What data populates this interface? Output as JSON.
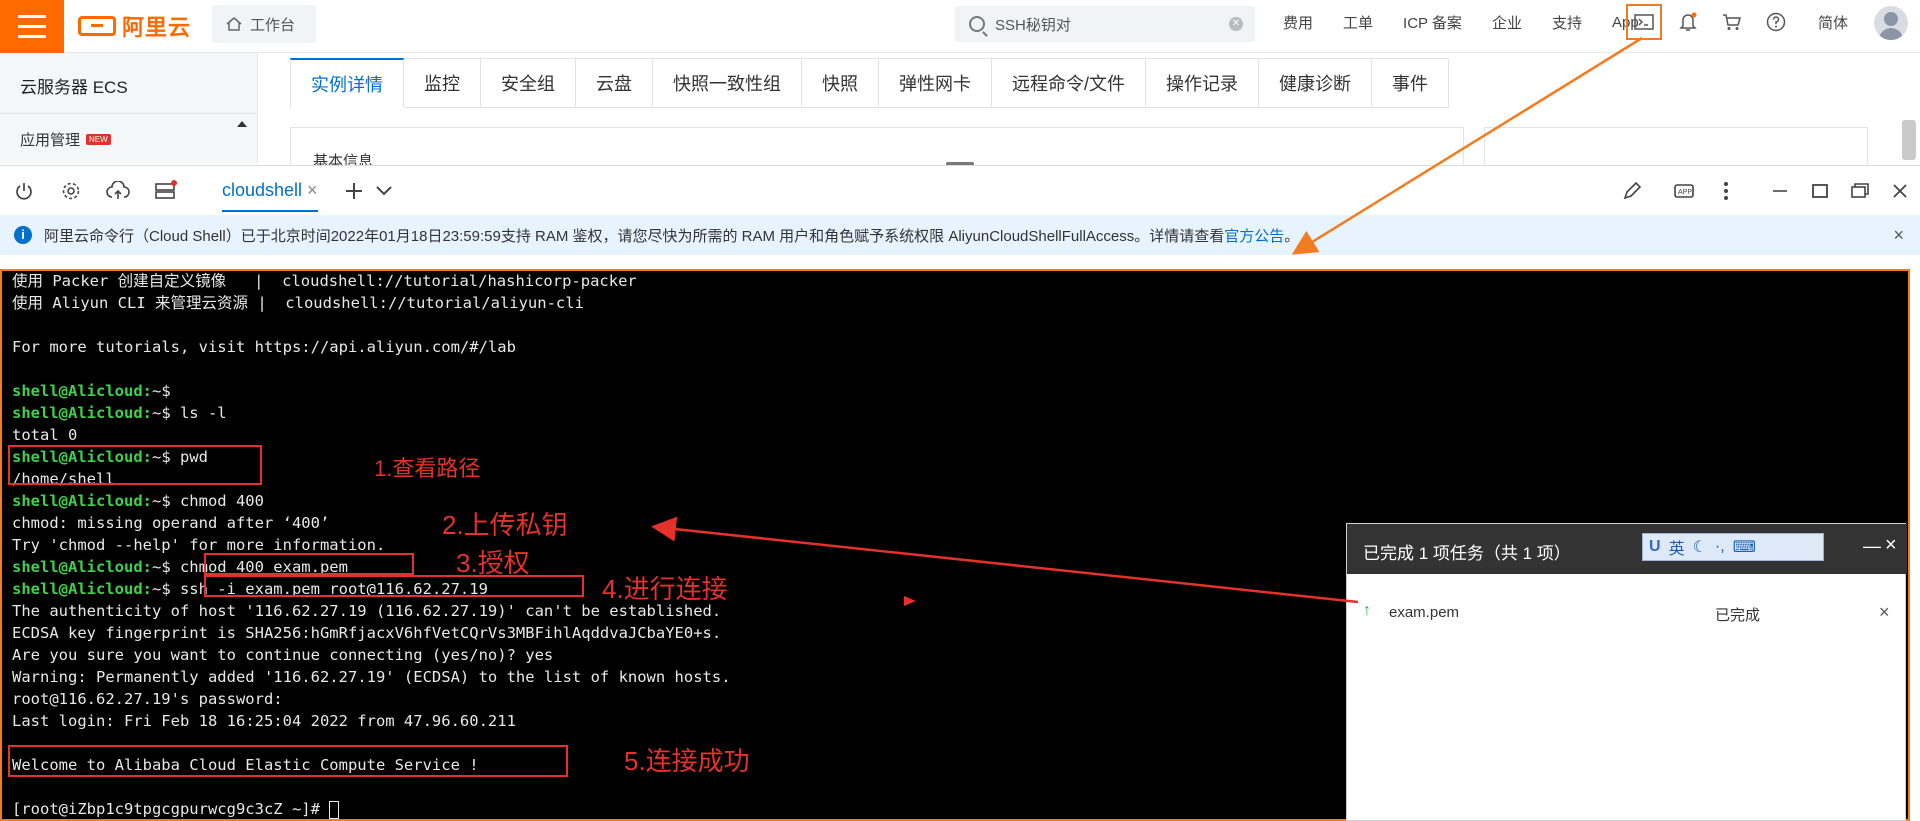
{
  "header": {
    "logo_text": "阿里云",
    "workbench_label": "工作台",
    "search_value": "SSH秘钥对",
    "nav": [
      "费用",
      "工单",
      "ICP 备案",
      "企业",
      "支持",
      "App"
    ],
    "language": "简体",
    "icons": [
      "terminal-icon",
      "bell-icon",
      "cart-icon",
      "help-icon"
    ]
  },
  "sidebar": {
    "product": "云服务器 ECS",
    "app_management": "应用管理",
    "new_badge": "NEW"
  },
  "tabs": [
    {
      "label": "实例详情",
      "active": true
    },
    {
      "label": "监控"
    },
    {
      "label": "安全组"
    },
    {
      "label": "云盘"
    },
    {
      "label": "快照一致性组"
    },
    {
      "label": "快照"
    },
    {
      "label": "弹性网卡"
    },
    {
      "label": "远程命令/文件"
    },
    {
      "label": "操作记录"
    },
    {
      "label": "健康诊断"
    },
    {
      "label": "事件"
    }
  ],
  "basic_info_label": "基本信息",
  "shell": {
    "tab_label": "cloudshell",
    "tab_close": "×",
    "notice_text": "阿里云命令行（Cloud Shell）已于北京时间2022年01月18日23:59:59支持 RAM 鉴权，请您尽快为所需的 RAM 用户和角色赋予系统权限 AliyunCloudShellFullAccess。详情请查看",
    "notice_link": "官方公告",
    "notice_end": "。",
    "notice_close": "×"
  },
  "terminal": {
    "lines": [
      {
        "text": "使用 Packer 创建自定义镜像   |  cloudshell://tutorial/hashicorp-packer"
      },
      {
        "text": "使用 Aliyun CLI 来管理云资源 |  cloudshell://tutorial/aliyun-cli"
      },
      {
        "text": ""
      },
      {
        "text": "For more tutorials, visit https://api.aliyun.com/#/lab"
      },
      {
        "text": ""
      },
      {
        "prompt": "shell@Alicloud:",
        "text": "~$"
      },
      {
        "prompt": "shell@Alicloud:",
        "text": "~$ ls -l"
      },
      {
        "text": "total 0"
      },
      {
        "prompt": "shell@Alicloud:",
        "text": "~$ pwd"
      },
      {
        "text": "/home/shell"
      },
      {
        "prompt": "shell@Alicloud:",
        "text": "~$ chmod 400"
      },
      {
        "text": "chmod: missing operand after ‘400’"
      },
      {
        "text": "Try 'chmod --help' for more information."
      },
      {
        "prompt": "shell@Alicloud:",
        "text": "~$ chmod 400 exam.pem"
      },
      {
        "prompt": "shell@Alicloud:",
        "text": "~$ ssh -i exam.pem root@116.62.27.19"
      },
      {
        "text": "The authenticity of host '116.62.27.19 (116.62.27.19)' can't be established."
      },
      {
        "text": "ECDSA key fingerprint is SHA256:hGmRfjacxV6hfVetCQrVs3MBFihlAqddvaJCbaYE0+s."
      },
      {
        "text": "Are you sure you want to continue connecting (yes/no)? yes"
      },
      {
        "text": "Warning: Permanently added '116.62.27.19' (ECDSA) to the list of known hosts."
      },
      {
        "text": "root@116.62.27.19's password:"
      },
      {
        "text": "Last login: Fri Feb 18 16:25:04 2022 from 47.96.60.211"
      },
      {
        "text": ""
      },
      {
        "text": "Welcome to Alibaba Cloud Elastic Compute Service !"
      },
      {
        "text": ""
      },
      {
        "text": "[root@iZbp1c9tpgcgpurwcg9c3cZ ~]# "
      }
    ]
  },
  "annotations": {
    "step1": "1.查看路径",
    "step2": "2.上传私钥",
    "step3": "3.授权",
    "step4": "4.进行连接",
    "step5": "5.连接成功",
    "color": "#e4312b",
    "arrow_color": "#f47c20"
  },
  "upload_dialog": {
    "title": "已完成 1 项任务（共 1 项）",
    "ime": [
      "英",
      "☾",
      "·,",
      "⌨"
    ],
    "file_name": "exam.pem",
    "status": "已完成",
    "close": "×",
    "minimize": "—"
  },
  "colors": {
    "brand": "#ff6a00",
    "link": "#0070cc",
    "prompt": "#3cd34a"
  }
}
